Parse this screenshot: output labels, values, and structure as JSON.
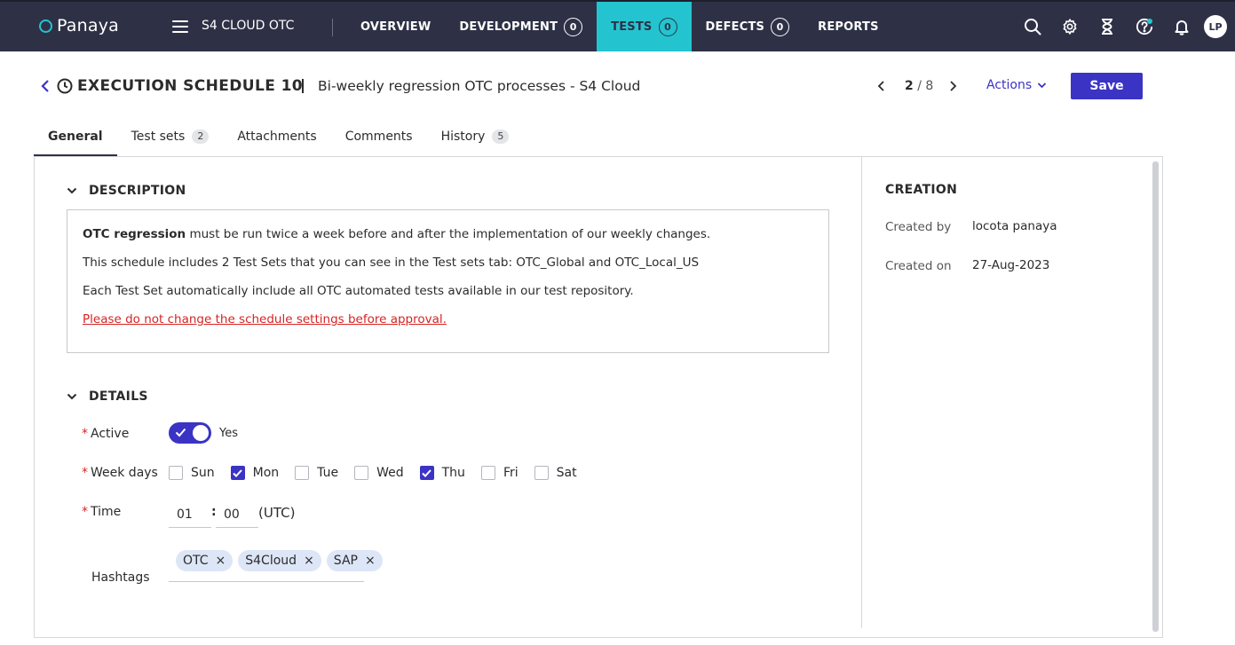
{
  "topbar": {
    "logo_text": "Panaya",
    "project_name": "S4 CLOUD OTC",
    "nav": [
      {
        "label": "OVERVIEW",
        "count": null
      },
      {
        "label": "DEVELOPMENT",
        "count": "0"
      },
      {
        "label": "TESTS",
        "count": "0"
      },
      {
        "label": "DEFECTS",
        "count": "0"
      },
      {
        "label": "REPORTS",
        "count": null
      }
    ],
    "active_nav": "TESTS",
    "avatar_initials": "LP",
    "icons": [
      "search-icon",
      "gear-icon",
      "hourglass-icon",
      "help-icon",
      "bell-icon"
    ]
  },
  "header": {
    "title": "EXECUTION SCHEDULE 10",
    "subtitle": "Bi-weekly regression OTC processes - S4 Cloud",
    "pager_current": "2",
    "pager_total": " / 8",
    "actions_label": "Actions",
    "save_label": "Save"
  },
  "tabs": [
    {
      "label": "General",
      "count": null
    },
    {
      "label": "Test sets",
      "count": "2"
    },
    {
      "label": "Attachments",
      "count": null
    },
    {
      "label": "Comments",
      "count": null
    },
    {
      "label": "History",
      "count": "5"
    }
  ],
  "description": {
    "heading": "DESCRIPTION",
    "line1_bold": "OTC regression",
    "line1_rest": " must be run twice a week before and after the implementation of our weekly changes.",
    "line2": "This schedule includes 2 Test Sets that you can see in the Test sets tab: OTC_Global and OTC_Local_US",
    "line3": "Each Test Set automatically include all OTC automated tests available in our test repository.",
    "warning_link": "Please do not change the schedule settings before approval."
  },
  "details": {
    "heading": "DETAILS",
    "active_label": "Active",
    "active_value": "Yes",
    "weekdays_label": "Week days",
    "weekdays": [
      {
        "label": "Sun",
        "checked": false
      },
      {
        "label": "Mon",
        "checked": true
      },
      {
        "label": "Tue",
        "checked": false
      },
      {
        "label": "Wed",
        "checked": false
      },
      {
        "label": "Thu",
        "checked": true
      },
      {
        "label": "Fri",
        "checked": false
      },
      {
        "label": "Sat",
        "checked": false
      }
    ],
    "time_label": "Time",
    "time_hour": "01",
    "time_minute": "00",
    "time_separator": ":",
    "time_zone": "(UTC)",
    "hashtags_label": "Hashtags",
    "hashtags": [
      "OTC",
      "S4Cloud",
      "SAP"
    ],
    "required_marker": "*",
    "remove_glyph": "×"
  },
  "creation": {
    "heading": "CREATION",
    "created_by_label": "Created by",
    "created_by_value": "locota panaya",
    "created_on_label": "Created on",
    "created_on_value": "27-Aug-2023"
  },
  "colors": {
    "topbar_bg": "#2e3146",
    "accent_teal": "#23c4cf",
    "primary_blue": "#3b33c4",
    "required_red": "#d62424"
  }
}
